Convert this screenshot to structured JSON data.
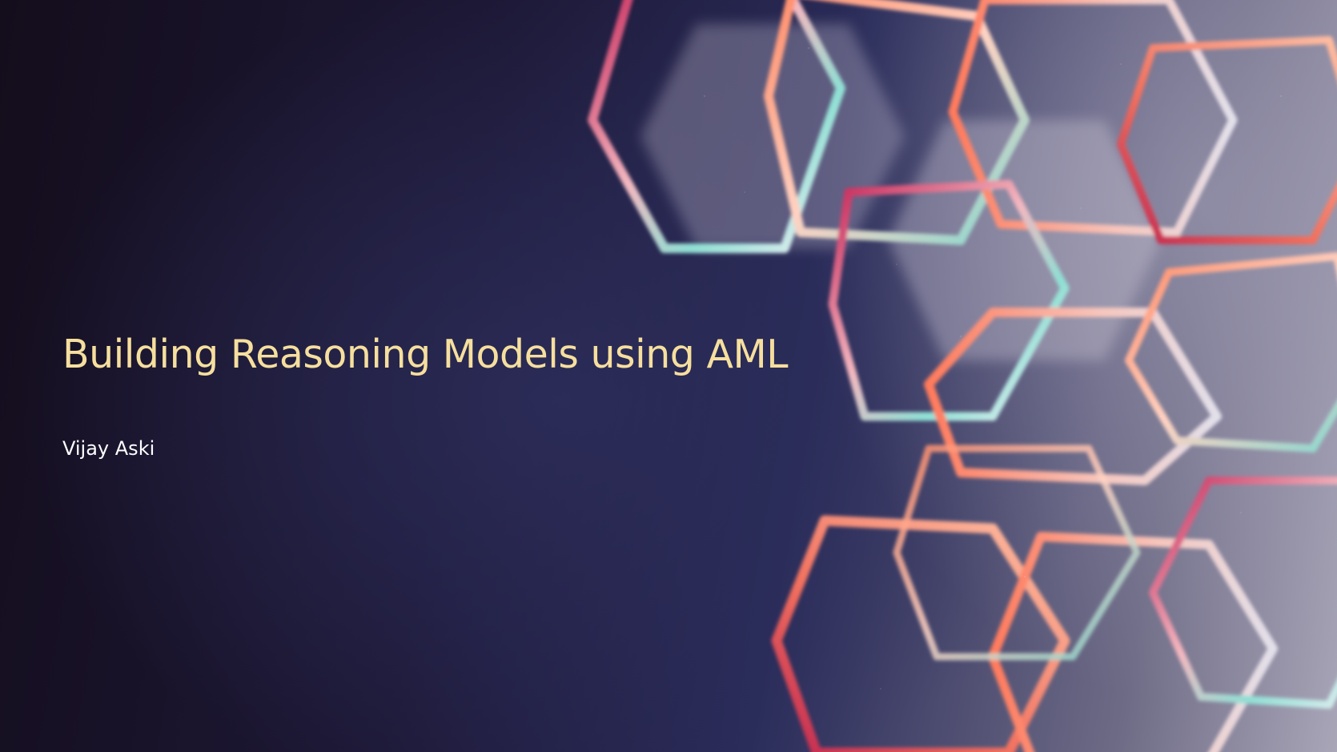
{
  "slide": {
    "title": "Building Reasoning Models using AML",
    "subtitle": "Vijay Aski"
  },
  "colors": {
    "title": "#f6df9e",
    "subtitle": "#ffffff",
    "background_dark": "#1c1733",
    "accent_coral": "#f2705e",
    "accent_teal": "#7fd8cf",
    "accent_crimson": "#c02550"
  },
  "decoration": {
    "image": "hexagon-ring-artwork"
  }
}
